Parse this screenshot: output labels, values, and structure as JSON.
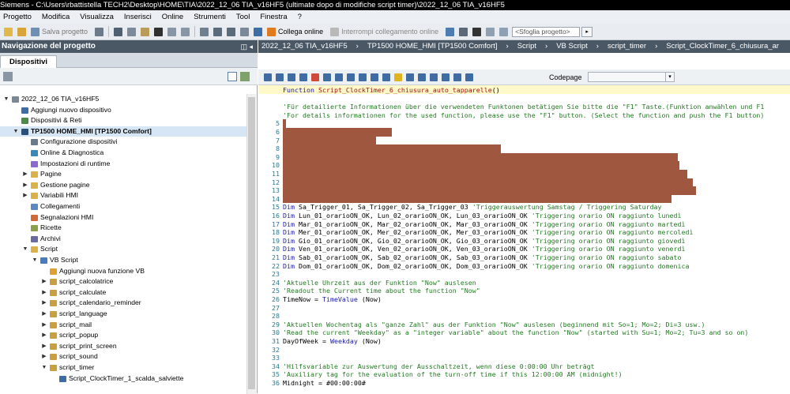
{
  "window": {
    "title": "Siemens  -  C:\\Users\\rbattistella TECH2\\Desktop\\HOME\\TIA\\2022_12_06 TIA_v16HF5 (ultimate dopo di modifiche script timer)\\2022_12_06 TIA_v16HF5"
  },
  "menu": [
    "Progetto",
    "Modifica",
    "Visualizza",
    "Inserisci",
    "Online",
    "Strumenti",
    "Tool",
    "Finestra",
    "?"
  ],
  "toolbar": {
    "save_label": "Salva progetto",
    "connect_label": "Collega online",
    "disconnect_label": "Interrompi collegamento online",
    "search_placeholder": "<Sfoglia progetto>"
  },
  "left_panel": {
    "title": "Navigazione del progetto",
    "pin": "◫ ◂",
    "tab": "Dispositivi",
    "tree": [
      {
        "label": "2022_12_06 TIA_v16HF5",
        "level": 0,
        "arrow": "down",
        "icon": "project-icon"
      },
      {
        "label": "Aggiungi nuovo dispositivo",
        "level": 1,
        "arrow": "",
        "icon": "add-device-icon"
      },
      {
        "label": "Dispositivi & Reti",
        "level": 1,
        "arrow": "",
        "icon": "network-icon"
      },
      {
        "label": "TP1500 HOME_HMI [TP1500 Comfort]",
        "level": 1,
        "arrow": "down",
        "icon": "hmi-icon",
        "bold": true,
        "selected": true
      },
      {
        "label": "Configurazione dispositivi",
        "level": 2,
        "arrow": "",
        "icon": "config-icon"
      },
      {
        "label": "Online & Diagnostica",
        "level": 2,
        "arrow": "",
        "icon": "diagnostic-icon"
      },
      {
        "label": "Impostazioni di runtime",
        "level": 2,
        "arrow": "",
        "icon": "runtime-icon"
      },
      {
        "label": "Pagine",
        "level": 2,
        "arrow": "right",
        "icon": "folder-icon"
      },
      {
        "label": "Gestione pagine",
        "level": 2,
        "arrow": "right",
        "icon": "folder-icon"
      },
      {
        "label": "Variabili HMI",
        "level": 2,
        "arrow": "right",
        "icon": "folder-icon"
      },
      {
        "label": "Collegamenti",
        "level": 2,
        "arrow": "",
        "icon": "connection-icon"
      },
      {
        "label": "Segnalazioni HMI",
        "level": 2,
        "arrow": "",
        "icon": "alarm-icon"
      },
      {
        "label": "Ricette",
        "level": 2,
        "arrow": "",
        "icon": "recipe-icon"
      },
      {
        "label": "Archivi",
        "level": 2,
        "arrow": "",
        "icon": "archive-icon"
      },
      {
        "label": "Script",
        "level": 2,
        "arrow": "down",
        "icon": "folder-icon"
      },
      {
        "label": "VB Script",
        "level": 3,
        "arrow": "down",
        "icon": "vb-folder-icon"
      },
      {
        "label": "Aggiungi nuova funzione VB",
        "level": 4,
        "arrow": "",
        "icon": "add-function-icon"
      },
      {
        "label": "script_calcolatrice",
        "level": 4,
        "arrow": "right",
        "icon": "script-folder-icon"
      },
      {
        "label": "script_calculate",
        "level": 4,
        "arrow": "right",
        "icon": "script-folder-icon"
      },
      {
        "label": "script_calendario_reminder",
        "level": 4,
        "arrow": "right",
        "icon": "script-folder-icon"
      },
      {
        "label": "script_language",
        "level": 4,
        "arrow": "right",
        "icon": "script-folder-icon"
      },
      {
        "label": "script_mail",
        "level": 4,
        "arrow": "right",
        "icon": "script-folder-icon"
      },
      {
        "label": "script_popup",
        "level": 4,
        "arrow": "right",
        "icon": "script-folder-icon"
      },
      {
        "label": "script_print_screen",
        "level": 4,
        "arrow": "right",
        "icon": "script-folder-icon"
      },
      {
        "label": "script_sound",
        "level": 4,
        "arrow": "right",
        "icon": "script-folder-icon"
      },
      {
        "label": "script_timer",
        "level": 4,
        "arrow": "down",
        "icon": "script-folder-icon"
      },
      {
        "label": "Script_ClockTimer_1_scalda_salviette",
        "level": 5,
        "arrow": "",
        "icon": "vb-function-icon"
      }
    ]
  },
  "editor": {
    "breadcrumb": [
      "2022_12_06 TIA_v16HF5",
      "TP1500 HOME_HMI [TP1500 Comfort]",
      "Script",
      "VB Script",
      "script_timer",
      "Script_ClockTimer_6_chiusura_ar"
    ],
    "codepage_label": "Codepage",
    "lines": [
      {
        "n": "",
        "segs": [
          {
            "t": "Function ",
            "c": "kw"
          },
          {
            "t": "Script_ClockTimer_6_chiusura_auto_tapparelle",
            "c": "fn"
          },
          {
            "t": "()",
            "c": ""
          }
        ]
      },
      {
        "n": "",
        "segs": []
      },
      {
        "n": "",
        "segs": [
          {
            "t": "'Für detailierte Informationen über die verwendeten Funktonen betätigen Sie bitte die \"F1\" Taste.(Funktion anwählen und F1",
            "c": "cm"
          }
        ]
      },
      {
        "n": "",
        "segs": [
          {
            "t": "'For details informationen for the used function, please use the \"F1\" button. (Select the function and push the F1 button)",
            "c": "cm"
          }
        ]
      },
      {
        "n": "5",
        "segs": [],
        "red": 4
      },
      {
        "n": "6",
        "segs": [],
        "red": 138
      },
      {
        "n": "7",
        "segs": [],
        "red": 118
      },
      {
        "n": "8",
        "segs": [],
        "red": 276
      },
      {
        "n": "9",
        "segs": [],
        "red": 500
      },
      {
        "n": "10",
        "segs": [],
        "red": 502
      },
      {
        "n": "11",
        "segs": [],
        "red": 512
      },
      {
        "n": "12",
        "segs": [],
        "red": 519
      },
      {
        "n": "13",
        "segs": [],
        "red": 523
      },
      {
        "n": "14",
        "segs": [],
        "red": 492
      },
      {
        "n": "15",
        "segs": [
          {
            "t": "Dim ",
            "c": "kw"
          },
          {
            "t": "Sa_Trigger_01, Sa_Trigger_02, Sa_Trigger_03 ",
            "c": ""
          },
          {
            "t": "'Triggerauswertung Samstag / Triggering Saturday",
            "c": "cm"
          }
        ]
      },
      {
        "n": "16",
        "segs": [
          {
            "t": "Dim ",
            "c": "kw"
          },
          {
            "t": "Lun_01_orarioON_OK, Lun_02_orarioON_OK, Lun_03_orarioON_OK ",
            "c": ""
          },
          {
            "t": "'Triggering orario ON raggiunto lunedì",
            "c": "cm"
          }
        ]
      },
      {
        "n": "17",
        "segs": [
          {
            "t": "Dim ",
            "c": "kw"
          },
          {
            "t": "Mar_01_orarioON_OK, Mar_02_orarioON_OK, Mar_03_orarioON_OK ",
            "c": ""
          },
          {
            "t": "'Triggering orario ON raggiunto martedì",
            "c": "cm"
          }
        ]
      },
      {
        "n": "18",
        "segs": [
          {
            "t": "Dim ",
            "c": "kw"
          },
          {
            "t": "Mer_01_orarioON_OK, Mer_02_orarioON_OK, Mer_03_orarioON_OK ",
            "c": ""
          },
          {
            "t": "'Triggering orario ON raggiunto mercoledì",
            "c": "cm"
          }
        ]
      },
      {
        "n": "19",
        "segs": [
          {
            "t": "Dim ",
            "c": "kw"
          },
          {
            "t": "Gio_01_orarioON_OK, Gio_02_orarioON_OK, Gio_03_orarioON_OK ",
            "c": ""
          },
          {
            "t": "'Triggering orario ON raggiunto giovedì",
            "c": "cm"
          }
        ]
      },
      {
        "n": "20",
        "segs": [
          {
            "t": "Dim ",
            "c": "kw"
          },
          {
            "t": "Ven_01_orarioON_OK, Ven_02_orarioON_OK, Ven_03_orarioON_OK ",
            "c": ""
          },
          {
            "t": "'Triggering orario ON raggiunto venerdì",
            "c": "cm"
          }
        ]
      },
      {
        "n": "21",
        "segs": [
          {
            "t": "Dim ",
            "c": "kw"
          },
          {
            "t": "Sab_01_orarioON_OK, Sab_02_orarioON_OK, Sab_03_orarioON_OK ",
            "c": ""
          },
          {
            "t": "'Triggering orario ON raggiunto sabato",
            "c": "cm"
          }
        ]
      },
      {
        "n": "22",
        "segs": [
          {
            "t": "Dim ",
            "c": "kw"
          },
          {
            "t": "Dom_01_orarioON_OK, Dom_02_orarioON_OK, Dom_03_orarioON_OK ",
            "c": ""
          },
          {
            "t": "'Triggering orario ON raggiunto domenica",
            "c": "cm"
          }
        ]
      },
      {
        "n": "23",
        "segs": []
      },
      {
        "n": "24",
        "segs": [
          {
            "t": "'Aktuelle Uhrzeit aus der Funktion \"Now\" auslesen",
            "c": "cm"
          }
        ]
      },
      {
        "n": "25",
        "segs": [
          {
            "t": "'Readout the Current time about the function \"Now\"",
            "c": "cm"
          }
        ]
      },
      {
        "n": "26",
        "segs": [
          {
            "t": "TimeNow = ",
            "c": ""
          },
          {
            "t": "TimeValue ",
            "c": "kw"
          },
          {
            "t": "(Now)",
            "c": ""
          }
        ]
      },
      {
        "n": "27",
        "segs": []
      },
      {
        "n": "28",
        "segs": []
      },
      {
        "n": "29",
        "segs": [
          {
            "t": "'Aktuellen Wochentag als \"ganze Zahl\" aus der Funktion \"Now\" auslesen (beginnend mit So=1; Mo=2; Di=3 usw.)",
            "c": "cm"
          }
        ]
      },
      {
        "n": "30",
        "segs": [
          {
            "t": "'Read the current \"Weekday\" as a \"integer variable\" about the function \"Now\" (started with Su=1; Mo=2; Tu=3 and so on)",
            "c": "cm"
          }
        ]
      },
      {
        "n": "31",
        "segs": [
          {
            "t": "DayOfWeek = ",
            "c": ""
          },
          {
            "t": "Weekday ",
            "c": "kw"
          },
          {
            "t": "(Now)",
            "c": ""
          }
        ]
      },
      {
        "n": "32",
        "segs": []
      },
      {
        "n": "33",
        "segs": []
      },
      {
        "n": "34",
        "segs": [
          {
            "t": "'Hilfsvariable zur Auswertung der Ausschaltzeit, wenn diese 0:00:00 Uhr beträgt",
            "c": "cm"
          }
        ]
      },
      {
        "n": "35",
        "segs": [
          {
            "t": "'Auxiliary tag for the evaluation of the turn-off time if this 12:00:00 AM (midnight!)",
            "c": "cm"
          }
        ]
      },
      {
        "n": "36",
        "segs": [
          {
            "t": "Midnight = #00:00:00#",
            "c": ""
          }
        ]
      }
    ]
  },
  "colors": {
    "accent": "#4a5866",
    "redaction": "#a0573f",
    "comment": "#237a23",
    "keyword": "#1a1aa6"
  }
}
